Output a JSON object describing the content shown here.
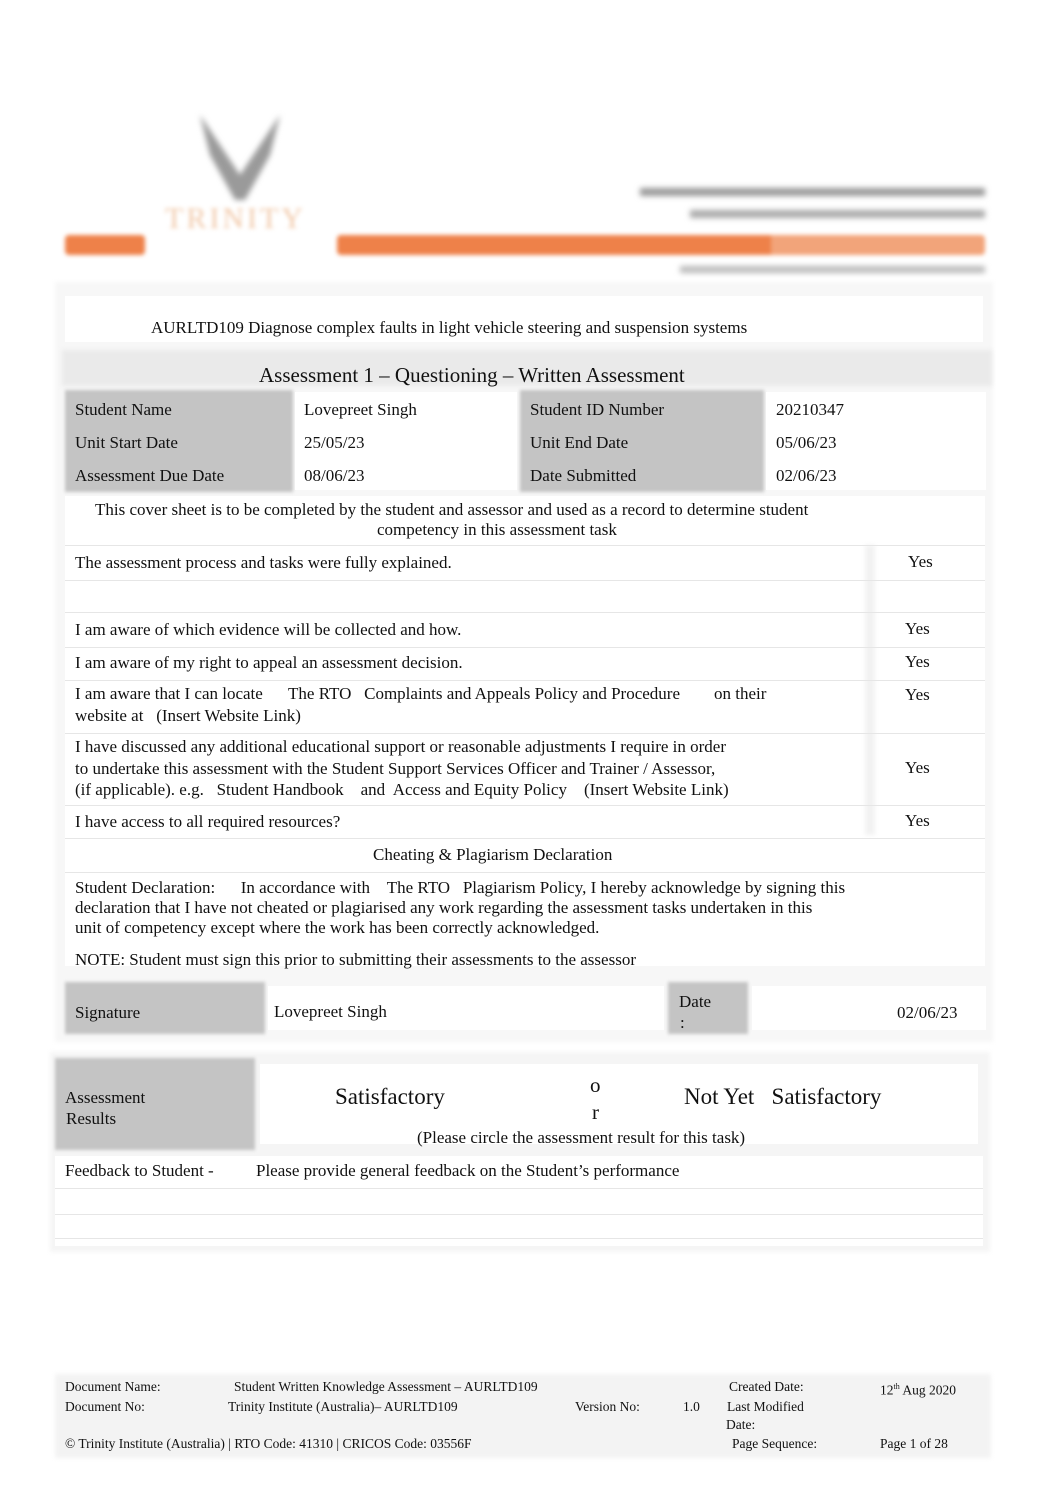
{
  "header": {
    "logo_text": "TRINITY",
    "brand_color": "#ee8149"
  },
  "unit_title": "AURLTD109 Diagnose complex faults in light vehicle steering and suspension systems",
  "assessment_title": "Assessment 1 – Questioning – Written Assessment",
  "details": [
    {
      "label": "Student Name",
      "value": "Lovepreet Singh",
      "label2": "Student ID Number",
      "value2": "20210347"
    },
    {
      "label": "Unit Start Date",
      "value": "25/05/23",
      "label2": "Unit End Date",
      "value2": "05/06/23"
    },
    {
      "label": "Assessment Due Date",
      "value": "08/06/23",
      "label2": "Date Submitted",
      "value2": "02/06/23"
    }
  ],
  "cover_note": [
    "This cover sheet is to be completed by the student and assessor and used as a record to determine student",
    "competency in this assessment task"
  ],
  "checklist": [
    {
      "lines": [
        "The assessment process and tasks were fully explained."
      ],
      "answer": "Yes"
    },
    {
      "lines": [
        "I am aware of which evidence will be collected and how."
      ],
      "answer": "Yes"
    },
    {
      "lines": [
        "I am aware of my right to appeal an assessment decision."
      ],
      "answer": "Yes"
    },
    {
      "lines": [
        "I am aware that I can locate      The RTO   Complaints and Appeals Policy and Procedure        on their",
        "website at   (Insert Website Link)"
      ],
      "answer": "Yes"
    },
    {
      "lines": [
        "I have discussed any additional educational support or reasonable adjustments I require in order",
        "to undertake this assessment with the Student Support Services Officer and Trainer / Assessor,",
        "(if applicable). e.g.   Student Handbook    and  Access and Equity Policy    (Insert Website Link)"
      ],
      "answer": "Yes"
    },
    {
      "lines": [
        "I have access to all required resources?"
      ],
      "answer": "Yes"
    }
  ],
  "declaration": {
    "heading": "Cheating & Plagiarism Declaration",
    "lines": [
      "Student Declaration:      In accordance with    The RTO   Plagiarism Policy, I hereby acknowledge by signing this",
      "declaration that I have not cheated or plagiarised any work regarding the assessment tasks undertaken in this",
      "unit of competency except where the work has been correctly acknowledged."
    ],
    "note": "NOTE: Student must sign this prior to submitting their assessments to the assessor"
  },
  "signature": {
    "label": "Signature",
    "value": "Lovepreet Singh",
    "date_label": "Date",
    "date_colon": ":",
    "date_value": "02/06/23"
  },
  "results": {
    "label_1": "Assessment",
    "label_2": "Results",
    "option1": "Satisfactory",
    "or_1": "o",
    "or_2": "r",
    "option2": "Not Yet   Satisfactory",
    "instruction": "(Please circle the assessment result for this task)"
  },
  "feedback": {
    "label": "Feedback to Student -",
    "text": "Please provide general feedback on the Student’s performance"
  },
  "footer": {
    "doc_name_label": "Document Name:",
    "doc_name": "Student Written Knowledge Assessment – AURLTD109",
    "created_label": "Created Date:",
    "created_day": "12",
    "created_sup": "th",
    "created_rest": " Aug 2020",
    "doc_no_label": "Document No:",
    "doc_no": "Trinity Institute (Australia)– AURLTD109",
    "version_label": "Version No:",
    "version": "1.0",
    "modified_label_1": "Last Modified",
    "modified_label_2": "Date:",
    "copyright": "© Trinity Institute (Australia) | RTO Code: 41310 | CRICOS Code: 03556F",
    "page_seq_label": "Page Sequence:",
    "page_seq": "Page 1 of 28"
  }
}
